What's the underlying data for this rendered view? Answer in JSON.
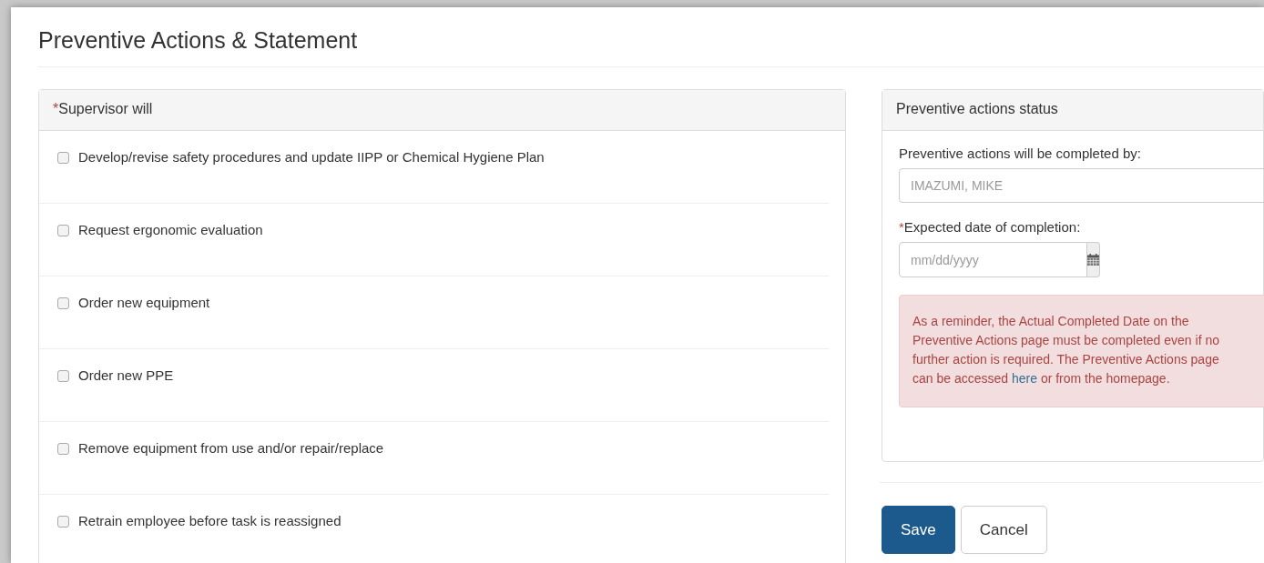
{
  "page": {
    "title": "Preventive Actions & Statement"
  },
  "supervisor_panel": {
    "title": "Supervisor will",
    "required_mark": "*",
    "items": [
      {
        "label": "Develop/revise safety procedures and update IIPP or Chemical Hygiene Plan",
        "checked": false
      },
      {
        "label": "Request ergonomic evaluation",
        "checked": false
      },
      {
        "label": "Order new equipment",
        "checked": false
      },
      {
        "label": "Order new PPE",
        "checked": false
      },
      {
        "label": "Remove equipment from use and/or repair/replace",
        "checked": false
      },
      {
        "label": "Retrain employee before task is reassigned",
        "checked": false
      }
    ]
  },
  "status_panel": {
    "title": "Preventive actions status",
    "completed_by": {
      "label": "Preventive actions will be completed by:",
      "value": "IMAZUMI, MIKE"
    },
    "expected_date": {
      "label": "Expected date of completion:",
      "required_mark": "*",
      "placeholder": "mm/dd/yyyy"
    },
    "alert": {
      "text": "As a reminder, the Actual Completed Date on the Preventive Actions page must be completed even if no further action is required. The Preventive Actions page can be accessed",
      "link": "here",
      "text_after": "or from the homepage."
    }
  },
  "buttons": [
    {
      "label": "Save",
      "kind": "primary"
    },
    {
      "label": "Cancel",
      "kind": "default"
    }
  ]
}
